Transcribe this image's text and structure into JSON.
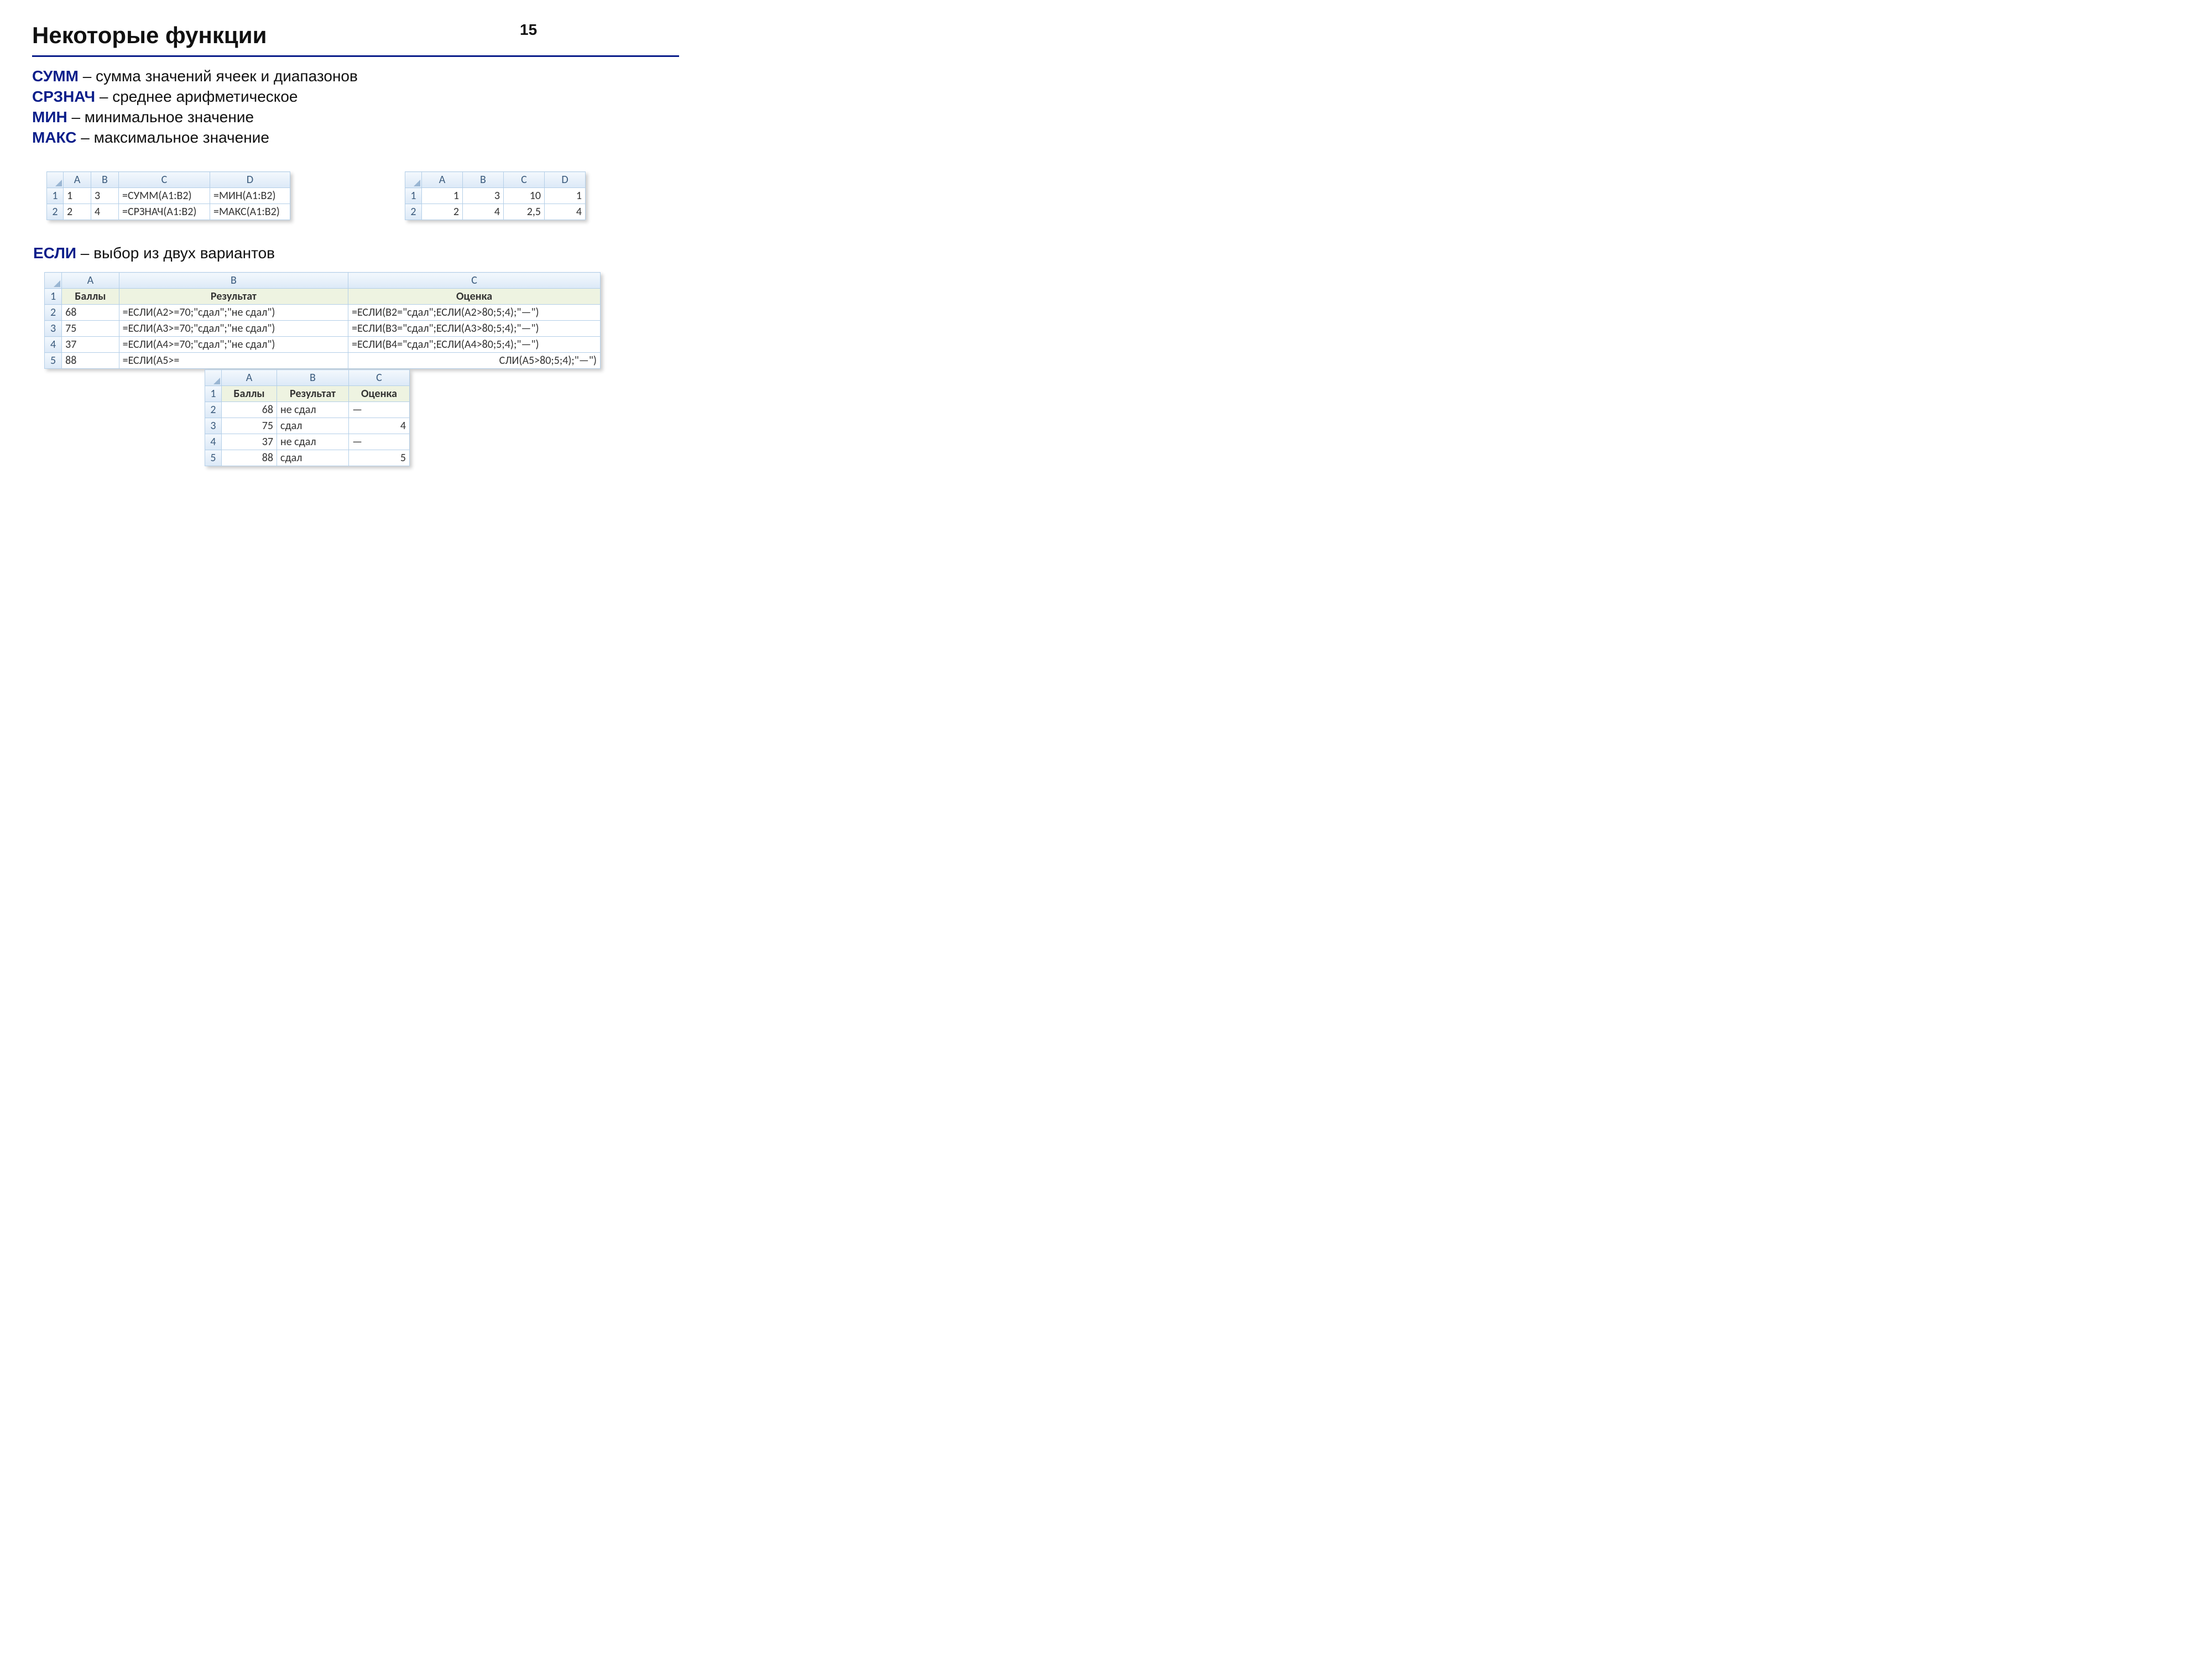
{
  "page_number": "15",
  "title": "Некоторые функции",
  "definitions": [
    {
      "kw": "СУММ",
      "desc": " – сумма значений ячеек и диапазонов"
    },
    {
      "kw": "СРЗНАЧ",
      "desc": " – среднее арифметическое"
    },
    {
      "kw": "МИН",
      "desc": " – минимальное значение"
    },
    {
      "kw": "МАКС",
      "desc": " – максимальное значение"
    }
  ],
  "if_line": {
    "kw": "ЕСЛИ",
    "desc": " – выбор из двух вариантов"
  },
  "columns": {
    "A": "A",
    "B": "B",
    "C": "C",
    "D": "D"
  },
  "tbl1": {
    "rows": [
      {
        "n": "1",
        "A": "1",
        "B": "3",
        "C": "=СУММ(A1:B2)",
        "D": "=МИН(A1:B2)"
      },
      {
        "n": "2",
        "A": "2",
        "B": "4",
        "C": "=СРЗНАЧ(A1:B2)",
        "D": "=МАКС(A1:B2)"
      }
    ]
  },
  "tbl2": {
    "rows": [
      {
        "n": "1",
        "A": "1",
        "B": "3",
        "C": "10",
        "D": "1"
      },
      {
        "n": "2",
        "A": "2",
        "B": "4",
        "C": "2,5",
        "D": "4"
      }
    ]
  },
  "tbl3": {
    "header": {
      "A": "Баллы",
      "B": "Результат",
      "C": "Оценка"
    },
    "rows": [
      {
        "n": "2",
        "A": "68",
        "B": "=ЕСЛИ(A2>=70;\"сдал\";\"не сдал\")",
        "C": "=ЕСЛИ(B2=\"сдал\";ЕСЛИ(A2>80;5;4);\"—\")"
      },
      {
        "n": "3",
        "A": "75",
        "B": "=ЕСЛИ(A3>=70;\"сдал\";\"не сдал\")",
        "C": "=ЕСЛИ(B3=\"сдал\";ЕСЛИ(A3>80;5;4);\"—\")"
      },
      {
        "n": "4",
        "A": "37",
        "B": "=ЕСЛИ(A4>=70;\"сдал\";\"не сдал\")",
        "C": "=ЕСЛИ(B4=\"сдал\";ЕСЛИ(A4>80;5;4);\"—\")"
      },
      {
        "n": "5",
        "A": "88",
        "B": "=ЕСЛИ(A5>=",
        "C": "СЛИ(A5>80;5;4);\"—\")"
      }
    ]
  },
  "tbl4": {
    "header": {
      "A": "Баллы",
      "B": "Результат",
      "C": "Оценка"
    },
    "rows": [
      {
        "n": "2",
        "A": "68",
        "B": "не сдал",
        "C": "—"
      },
      {
        "n": "3",
        "A": "75",
        "B": "сдал",
        "C": "4"
      },
      {
        "n": "4",
        "A": "37",
        "B": "не сдал",
        "C": "—"
      },
      {
        "n": "5",
        "A": "88",
        "B": "сдал",
        "C": "5"
      }
    ]
  }
}
